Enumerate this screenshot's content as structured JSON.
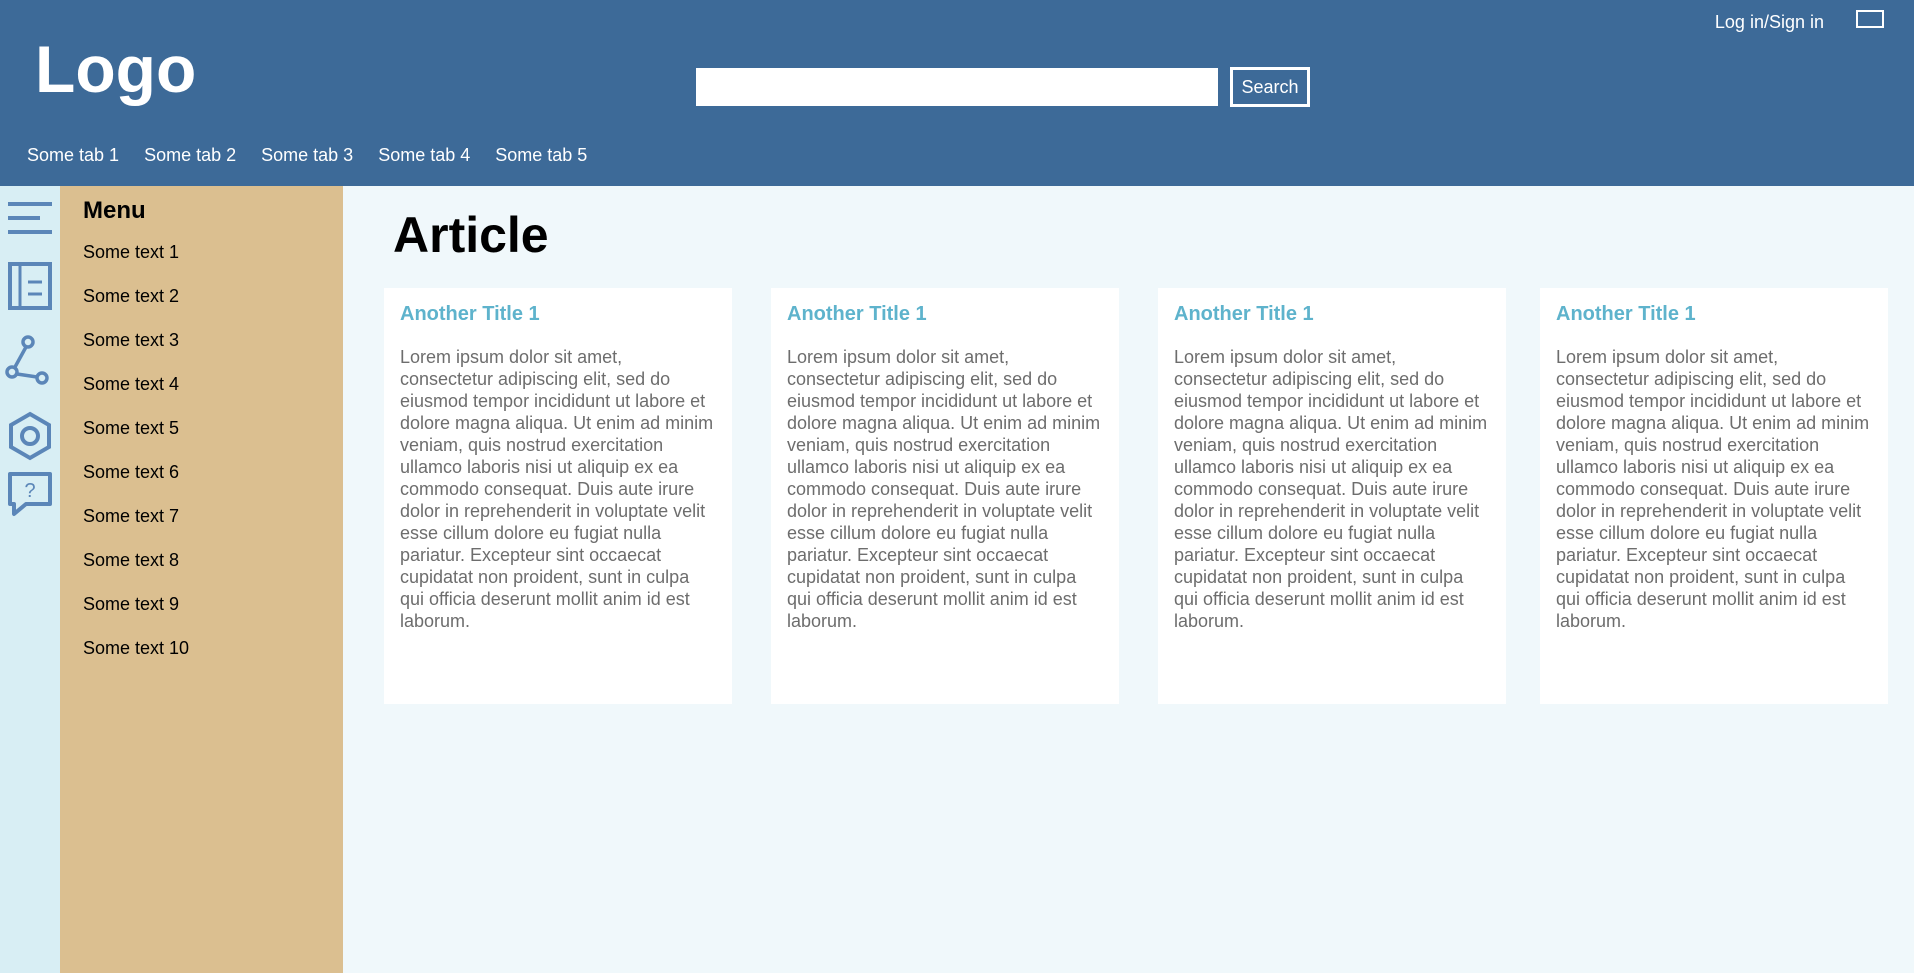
{
  "header": {
    "logo": "Logo",
    "login_label": "Log in/Sign in",
    "search": {
      "value": "",
      "button_label": "Search"
    },
    "tabs": [
      "Some tab 1",
      "Some tab 2",
      "Some tab 3",
      "Some tab 4",
      "Some tab 5"
    ]
  },
  "rail": {
    "icons": [
      "hamburger-icon",
      "article-icon",
      "share-icon",
      "settings-icon",
      "help-icon"
    ]
  },
  "sidebar": {
    "title": "Menu",
    "items": [
      "Some text 1",
      "Some text 2",
      "Some text 3",
      "Some text 4",
      "Some text 5",
      "Some text 6",
      "Some text 7",
      "Some text 8",
      "Some text 9",
      "Some text 10"
    ]
  },
  "main": {
    "title": "Article",
    "cards": [
      {
        "title": "Another Title 1",
        "body": "Lorem ipsum dolor sit amet, consectetur adipiscing elit, sed do eiusmod tempor incididunt ut labore et dolore magna aliqua. Ut enim ad minim veniam, quis nostrud exercitation ullamco laboris nisi ut aliquip ex ea commodo consequat. Duis aute irure dolor in reprehenderit in voluptate velit esse cillum dolore eu fugiat nulla pariatur. Excepteur sint occaecat cupidatat non proident, sunt in culpa qui officia deserunt mollit anim id est laborum."
      },
      {
        "title": "Another Title 1",
        "body": "Lorem ipsum dolor sit amet, consectetur adipiscing elit, sed do eiusmod tempor incididunt ut labore et dolore magna aliqua. Ut enim ad minim veniam, quis nostrud exercitation ullamco laboris nisi ut aliquip ex ea commodo consequat. Duis aute irure dolor in reprehenderit in voluptate velit esse cillum dolore eu fugiat nulla pariatur. Excepteur sint occaecat cupidatat non proident, sunt in culpa qui officia deserunt mollit anim id est laborum."
      },
      {
        "title": "Another Title 1",
        "body": "Lorem ipsum dolor sit amet, consectetur adipiscing elit, sed do eiusmod tempor incididunt ut labore et dolore magna aliqua. Ut enim ad minim veniam, quis nostrud exercitation ullamco laboris nisi ut aliquip ex ea commodo consequat. Duis aute irure dolor in reprehenderit in voluptate velit esse cillum dolore eu fugiat nulla pariatur. Excepteur sint occaecat cupidatat non proident, sunt in culpa qui officia deserunt mollit anim id est laborum."
      },
      {
        "title": "Another Title 1",
        "body": "Lorem ipsum dolor sit amet, consectetur adipiscing elit, sed do eiusmod tempor incididunt ut labore et dolore magna aliqua. Ut enim ad minim veniam, quis nostrud exercitation ullamco laboris nisi ut aliquip ex ea commodo consequat. Duis aute irure dolor in reprehenderit in voluptate velit esse cillum dolore eu fugiat nulla pariatur. Excepteur sint occaecat cupidatat non proident, sunt in culpa qui officia deserunt mollit anim id est laborum."
      }
    ]
  },
  "colors": {
    "header_bg": "#3d6a98",
    "rail_bg": "#d8eef4",
    "sidebar_bg": "#dbbf90",
    "main_bg": "#f0f8fb",
    "card_title": "#5eb3cc",
    "icon": "#5b86b8"
  }
}
